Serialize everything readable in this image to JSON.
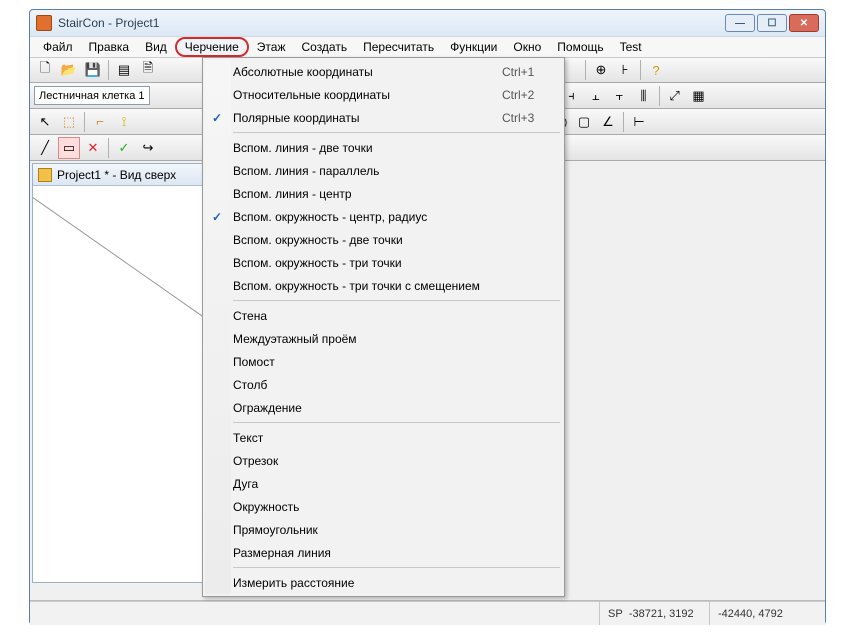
{
  "window": {
    "title": "StairCon - Project1"
  },
  "menubar": {
    "items": [
      "Файл",
      "Правка",
      "Вид",
      "Черчение",
      "Этаж",
      "Создать",
      "Пересчитать",
      "Функции",
      "Окно",
      "Помощь",
      "Test"
    ],
    "active_index": 3
  },
  "toolbar_input": {
    "value": "Лестничная клетка 1"
  },
  "doc": {
    "title": "Project1 * - Вид сверх"
  },
  "statusbar": {
    "sp_label": "SP",
    "sp_coords": "-38721, 3192",
    "coords": "-42440, 4792"
  },
  "dropdown": [
    {
      "type": "item",
      "label": "Абсолютные координаты",
      "shortcut": "Ctrl+1",
      "checked": false
    },
    {
      "type": "item",
      "label": "Относительные координаты",
      "shortcut": "Ctrl+2",
      "checked": false
    },
    {
      "type": "item",
      "label": "Полярные координаты",
      "shortcut": "Ctrl+3",
      "checked": true
    },
    {
      "type": "sep"
    },
    {
      "type": "item",
      "label": "Вспом. линия - две точки",
      "shortcut": "",
      "checked": false
    },
    {
      "type": "item",
      "label": "Вспом. линия - параллель",
      "shortcut": "",
      "checked": false
    },
    {
      "type": "item",
      "label": "Вспом. линия - центр",
      "shortcut": "",
      "checked": false
    },
    {
      "type": "item",
      "label": "Вспом. окружность - центр, радиус",
      "shortcut": "",
      "checked": true
    },
    {
      "type": "item",
      "label": "Вспом. окружность - две точки",
      "shortcut": "",
      "checked": false
    },
    {
      "type": "item",
      "label": "Вспом. окружность - три точки",
      "shortcut": "",
      "checked": false
    },
    {
      "type": "item",
      "label": "Вспом. окружность - три точки c смещением",
      "shortcut": "",
      "checked": false
    },
    {
      "type": "sep"
    },
    {
      "type": "item",
      "label": "Стена",
      "shortcut": "",
      "checked": false
    },
    {
      "type": "item",
      "label": "Междуэтажный проём",
      "shortcut": "",
      "checked": false
    },
    {
      "type": "item",
      "label": "Помост",
      "shortcut": "",
      "checked": false
    },
    {
      "type": "item",
      "label": "Столб",
      "shortcut": "",
      "checked": false
    },
    {
      "type": "item",
      "label": "Ограждение",
      "shortcut": "",
      "checked": false
    },
    {
      "type": "sep"
    },
    {
      "type": "item",
      "label": "Текст",
      "shortcut": "",
      "checked": false
    },
    {
      "type": "item",
      "label": "Отрезок",
      "shortcut": "",
      "checked": false
    },
    {
      "type": "item",
      "label": "Дуга",
      "shortcut": "",
      "checked": false
    },
    {
      "type": "item",
      "label": "Окружность",
      "shortcut": "",
      "checked": false
    },
    {
      "type": "item",
      "label": "Прямоугольник",
      "shortcut": "",
      "checked": false
    },
    {
      "type": "item",
      "label": "Размерная линия",
      "shortcut": "",
      "checked": false
    },
    {
      "type": "sep"
    },
    {
      "type": "item",
      "label": "Измерить расстояние",
      "shortcut": "",
      "checked": false
    }
  ]
}
